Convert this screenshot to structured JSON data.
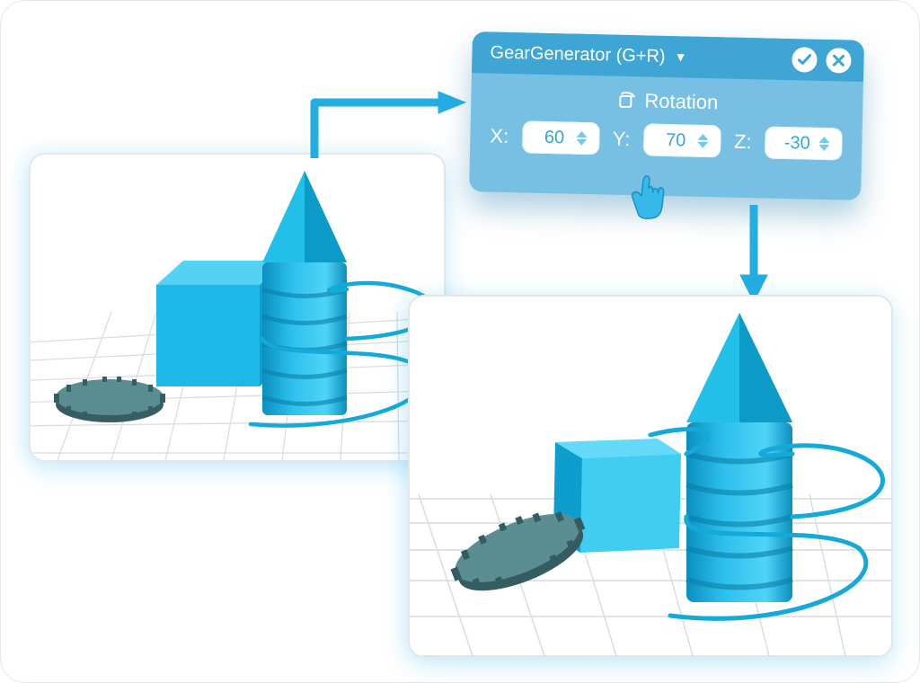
{
  "panel": {
    "title": "GearGenerator (G+R)",
    "section": "Rotation",
    "fields": {
      "x_label": "X:",
      "y_label": "Y:",
      "z_label": "Z:",
      "x_value": "60",
      "y_value": "70",
      "z_value": "-30"
    },
    "icons": {
      "confirm": "check-icon",
      "close": "close-icon",
      "expand": "chevron-down-icon",
      "rotation": "rotation-icon"
    }
  },
  "arrows": {
    "to_panel": "arrow-to-panel",
    "to_result": "arrow-to-result"
  },
  "colors": {
    "accent": "#22aee3",
    "panel_header": "#3fa5d4",
    "panel_body": "#77bfe3",
    "object_light": "#38c7ef",
    "object_dark": "#0f94c5",
    "gear": "#46767c"
  },
  "scenes": {
    "before": "scene-before-rotation",
    "after": "scene-after-rotation"
  }
}
